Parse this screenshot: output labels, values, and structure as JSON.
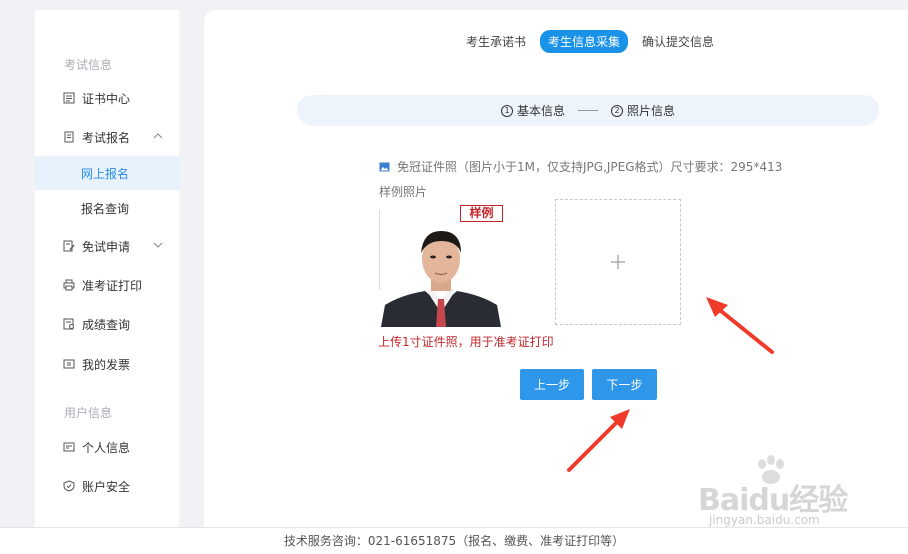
{
  "sidebar": {
    "section_exam": "考试信息",
    "section_user": "用户信息",
    "items": {
      "cert": "证书中心",
      "exam_reg": "考试报名",
      "online_reg": "网上报名",
      "reg_query": "报名查询",
      "exemption": "免试申请",
      "admission_print": "准考证打印",
      "score_query": "成绩查询",
      "invoice": "我的发票",
      "personal_info": "个人信息",
      "account_security": "账户安全"
    },
    "active_item": "网上报名"
  },
  "tabs": [
    {
      "label": "考生承诺书"
    },
    {
      "label": "考生信息采集"
    },
    {
      "label": "确认提交信息"
    }
  ],
  "steps": [
    {
      "num": "1",
      "label": "基本信息"
    },
    {
      "num": "2",
      "label": "照片信息"
    }
  ],
  "upload": {
    "hint": "免冠证件照（图片小于1M，仅支持JPG,JPEG格式）尺寸要求：295*413",
    "sample_label": "样例照片",
    "badge": "样例",
    "note": "上传1寸证件照，用于准考证打印"
  },
  "buttons": {
    "prev": "上一步",
    "next": "下一步"
  },
  "footer": {
    "text": "技术服务咨询：021-61651875（报名、缴费、准考证打印等）"
  },
  "watermark": {
    "logo": "Baidu经验",
    "url": "jingyan.baidu.com"
  },
  "colors": {
    "accent": "#2e97ea",
    "active_bg": "#e8f2fd",
    "warning_red": "#c3272b",
    "arrow_red": "#f03a2a"
  }
}
